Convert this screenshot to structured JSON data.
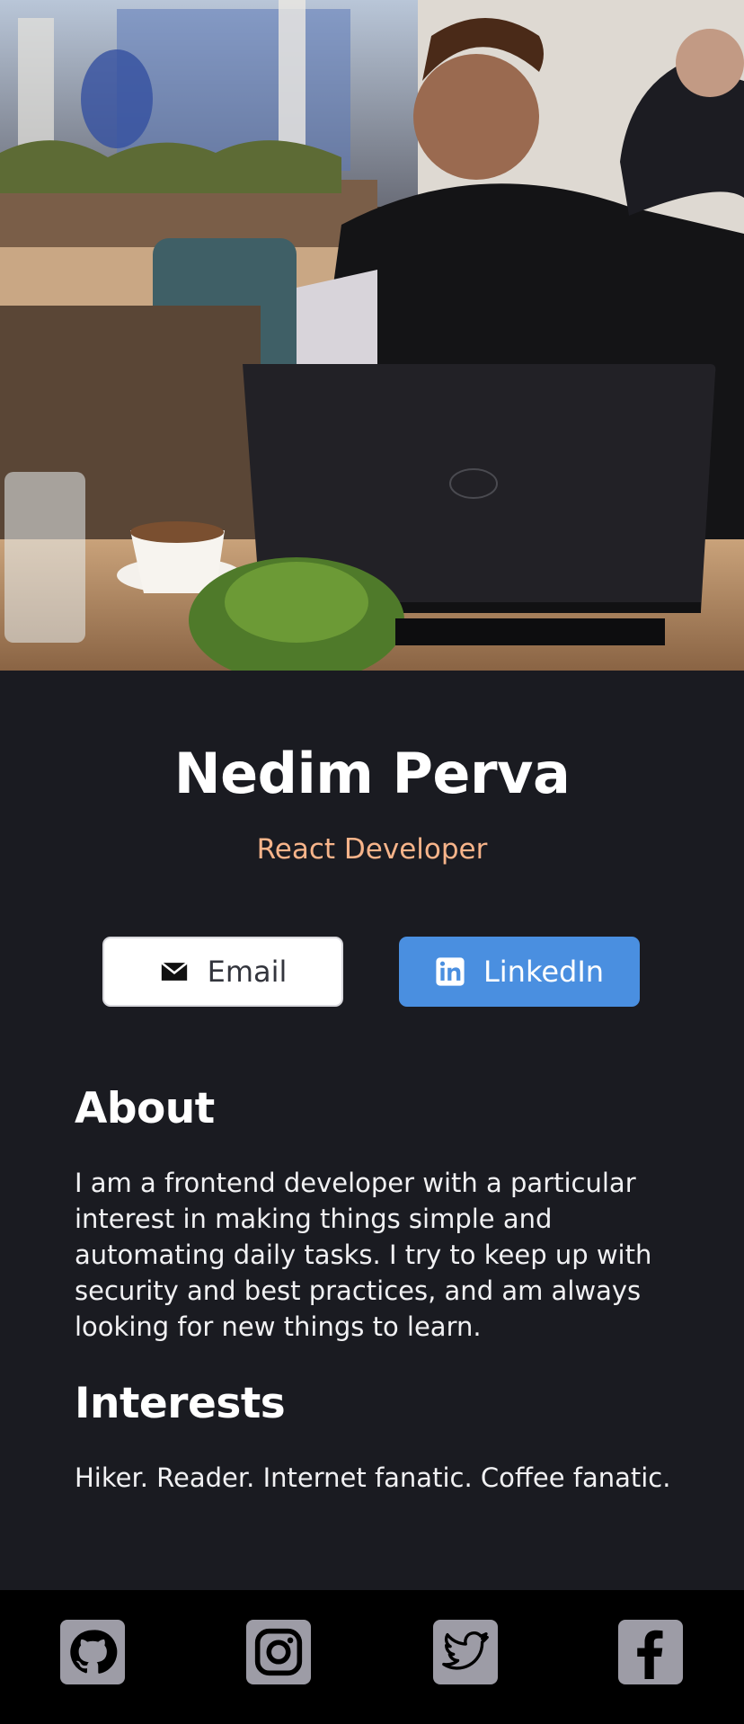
{
  "profile": {
    "name": "Nedim Perva",
    "role": "React Developer"
  },
  "actions": {
    "email_label": "Email",
    "linkedin_label": "LinkedIn"
  },
  "about": {
    "heading": "About",
    "text": "I am a frontend developer with a particular interest in making things simple and automating daily tasks. I try to keep up with security and best practices, and am always looking for new things to learn."
  },
  "interests": {
    "heading": "Interests",
    "text": "Hiker. Reader. Internet fanatic. Coffee fanatic."
  },
  "footer": {
    "icons": [
      "github-icon",
      "instagram-icon",
      "twitter-icon",
      "facebook-icon"
    ]
  },
  "colors": {
    "background": "#1a1b21",
    "accent_role": "#f7b48a",
    "linkedin_button": "#4a8fe0",
    "email_button": "#ffffff",
    "footer": "#000000",
    "social_icon_bg": "#9d9ca6"
  }
}
